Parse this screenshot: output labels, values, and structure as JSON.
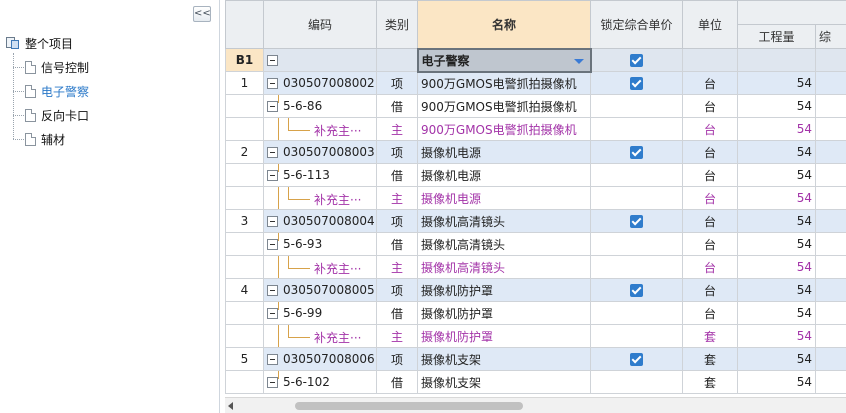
{
  "tree": {
    "collapse_label": "<<",
    "root_label": "整个项目",
    "items": [
      {
        "label": "信号控制",
        "selected": false
      },
      {
        "label": "电子警察",
        "selected": true
      },
      {
        "label": "反向卡口",
        "selected": false
      },
      {
        "label": "辅材",
        "selected": false
      }
    ]
  },
  "grid": {
    "headers": {
      "code": "编码",
      "type": "类别",
      "name": "名称",
      "lock_price": "锁定综合单价",
      "unit": "单位",
      "quantity": "工程量",
      "overflow": "综"
    },
    "section": {
      "rownum": "B1",
      "name": "电子警察",
      "locked": true
    },
    "rows": [
      {
        "kind": "qd",
        "rownum": "1",
        "code": "030507008002",
        "type": "项",
        "name": "900万GMOS电警抓拍摄像机",
        "locked": true,
        "unit": "台",
        "qty": "54"
      },
      {
        "kind": "de",
        "rownum": "",
        "code": "5-6-86",
        "type": "借",
        "name": "900万GMOS电警抓拍摄像机",
        "locked": false,
        "unit": "台",
        "qty": "54"
      },
      {
        "kind": "bc",
        "rownum": "",
        "code": "补充主···",
        "type": "主",
        "name": "900万GMOS电警抓拍摄像机",
        "locked": false,
        "unit": "台",
        "qty": "54"
      },
      {
        "kind": "qd",
        "rownum": "2",
        "code": "030507008003",
        "type": "项",
        "name": "摄像机电源",
        "locked": true,
        "unit": "台",
        "qty": "54"
      },
      {
        "kind": "de",
        "rownum": "",
        "code": "5-6-113",
        "type": "借",
        "name": "摄像机电源",
        "locked": false,
        "unit": "台",
        "qty": "54"
      },
      {
        "kind": "bc",
        "rownum": "",
        "code": "补充主···",
        "type": "主",
        "name": "摄像机电源",
        "locked": false,
        "unit": "台",
        "qty": "54"
      },
      {
        "kind": "qd",
        "rownum": "3",
        "code": "030507008004",
        "type": "项",
        "name": "摄像机高清镜头",
        "locked": true,
        "unit": "台",
        "qty": "54"
      },
      {
        "kind": "de",
        "rownum": "",
        "code": "5-6-93",
        "type": "借",
        "name": "摄像机高清镜头",
        "locked": false,
        "unit": "台",
        "qty": "54"
      },
      {
        "kind": "bc",
        "rownum": "",
        "code": "补充主···",
        "type": "主",
        "name": "摄像机高清镜头",
        "locked": false,
        "unit": "台",
        "qty": "54"
      },
      {
        "kind": "qd",
        "rownum": "4",
        "code": "030507008005",
        "type": "项",
        "name": "摄像机防护罩",
        "locked": true,
        "unit": "台",
        "qty": "54"
      },
      {
        "kind": "de",
        "rownum": "",
        "code": "5-6-99",
        "type": "借",
        "name": "摄像机防护罩",
        "locked": false,
        "unit": "台",
        "qty": "54"
      },
      {
        "kind": "bc",
        "rownum": "",
        "code": "补充主···",
        "type": "主",
        "name": "摄像机防护罩",
        "locked": false,
        "unit": "套",
        "qty": "54"
      },
      {
        "kind": "qd",
        "rownum": "5",
        "code": "030507008006",
        "type": "项",
        "name": "摄像机支架",
        "locked": true,
        "unit": "套",
        "qty": "54"
      },
      {
        "kind": "de",
        "rownum": "",
        "code": "5-6-102",
        "type": "借",
        "name": "摄像机支架",
        "locked": false,
        "unit": "套",
        "qty": "54"
      }
    ]
  },
  "colors": {
    "qd_row_bg": "#dfe9f6",
    "supplement_text": "#a333a8",
    "header_highlight": "#fbe6c5",
    "checkbox": "#2f7ccc"
  }
}
